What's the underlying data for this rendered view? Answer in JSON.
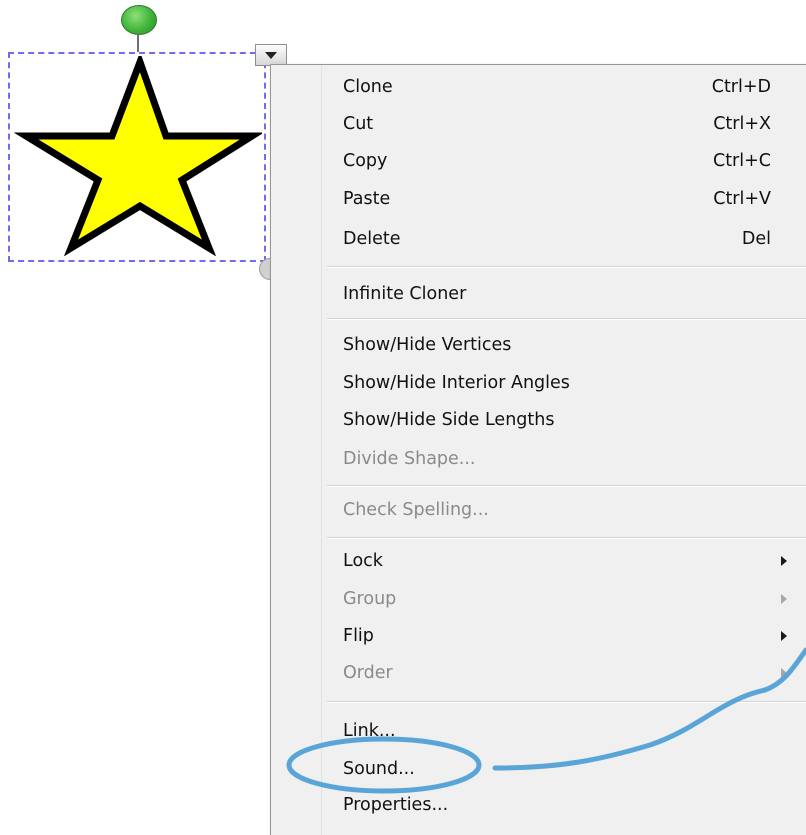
{
  "menu": {
    "items": [
      {
        "label": "Clone",
        "shortcut": "Ctrl+D",
        "enabled": true
      },
      {
        "label": "Cut",
        "shortcut": "Ctrl+X",
        "enabled": true
      },
      {
        "label": "Copy",
        "shortcut": "Ctrl+C",
        "enabled": true
      },
      {
        "label": "Paste",
        "shortcut": "Ctrl+V",
        "enabled": true
      },
      {
        "label": "Delete",
        "shortcut": "Del",
        "enabled": true
      },
      {
        "label": "Infinite Cloner",
        "enabled": true
      },
      {
        "label": "Show/Hide Vertices",
        "enabled": true
      },
      {
        "label": "Show/Hide Interior Angles",
        "enabled": true
      },
      {
        "label": "Show/Hide Side Lengths",
        "enabled": true
      },
      {
        "label": "Divide Shape...",
        "enabled": false
      },
      {
        "label": "Check Spelling...",
        "enabled": false
      },
      {
        "label": "Lock",
        "enabled": true,
        "submenu": true
      },
      {
        "label": "Group",
        "enabled": false,
        "submenu": true
      },
      {
        "label": "Flip",
        "enabled": true,
        "submenu": true
      },
      {
        "label": "Order",
        "enabled": false,
        "submenu": true
      },
      {
        "label": "Link...",
        "enabled": true
      },
      {
        "label": "Sound...",
        "enabled": true,
        "highlighted": true
      },
      {
        "label": "Properties...",
        "enabled": true
      }
    ]
  },
  "colors": {
    "star_fill": "#ffff00",
    "selection_border": "#6f6cf3",
    "annotation": "#5aa5d8",
    "rotate_handle": "#3fb43a"
  },
  "icons": {
    "rotate_handle": "green-circle-icon",
    "menu_button": "dropdown-arrow-icon",
    "shape": "star-icon"
  }
}
